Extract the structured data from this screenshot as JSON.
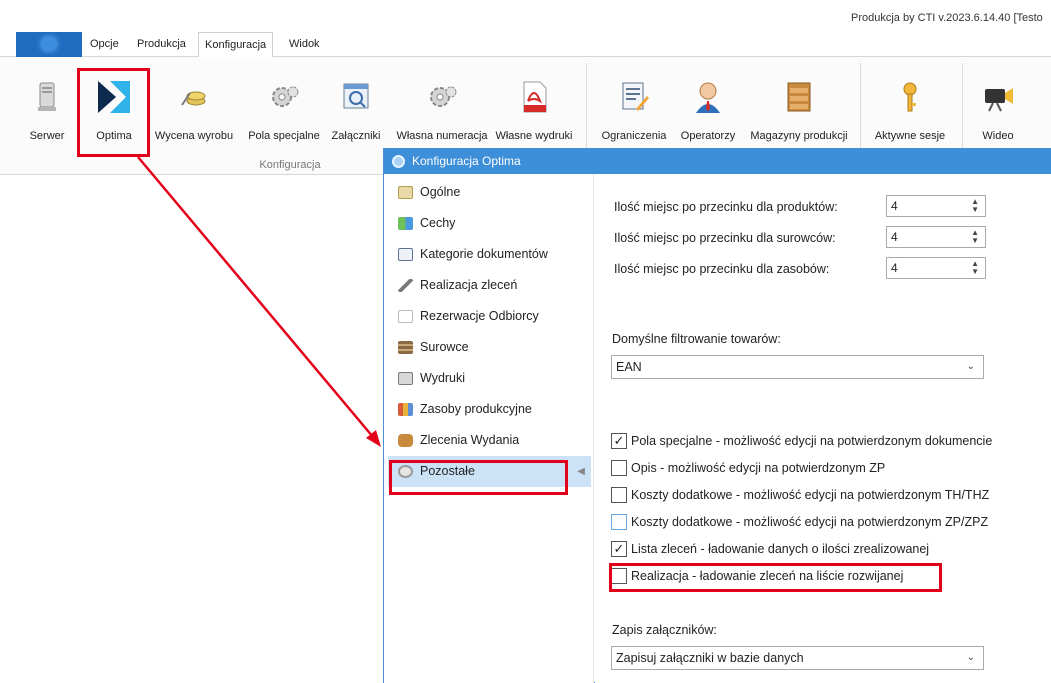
{
  "app": {
    "title": "Produkcja by CTI v.2023.6.14.40 [Testo"
  },
  "menu": {
    "tabs": [
      "Opcje",
      "Produkcja",
      "Konfiguracja",
      "Widok"
    ],
    "active": "Konfiguracja"
  },
  "ribbon": {
    "buttons": {
      "serwer": "Serwer",
      "optima": "Optima",
      "wycena": "Wycena wyrobu",
      "pola": "Pola specjalne",
      "zalaczniki": "Załączniki",
      "numeracja": "Własna numeracja",
      "wydruki": "Własne wydruki",
      "ograniczenia": "Ograniczenia",
      "operatorzy": "Operatorzy",
      "magazyny": "Magazyny produkcji",
      "sesje": "Aktywne sesje",
      "wideo": "Wideo"
    },
    "group_label": "Konfiguracja"
  },
  "dialog": {
    "title": "Konfiguracja Optima",
    "nav": [
      "Ogólne",
      "Cechy",
      "Kategorie dokumentów",
      "Realizacja zleceń",
      "Rezerwacje Odbiorcy",
      "Surowce",
      "Wydruki",
      "Zasoby produkcyjne",
      "Zlecenia Wydania",
      "Pozostałe"
    ],
    "selected_nav": "Pozostałe",
    "decimals": {
      "produkty_label": "Ilość miejsc po przecinku dla produktów:",
      "produkty_value": "4",
      "surowce_label": "Ilość miejsc po przecinku dla surowców:",
      "surowce_value": "4",
      "zasoby_label": "Ilość miejsc po przecinku dla zasobów:",
      "zasoby_value": "4"
    },
    "filter": {
      "label": "Domyślne filtrowanie towarów:",
      "value": "EAN"
    },
    "checkboxes": [
      {
        "label": "Pola specjalne - możliwość edycji na potwierdzonym dokumencie",
        "checked": true
      },
      {
        "label": "Opis - możliwość edycji na potwierdzonym ZP",
        "checked": false
      },
      {
        "label": "Koszty dodatkowe - możliwość edycji na potwierdzonym TH/THZ",
        "checked": false
      },
      {
        "label": "Koszty dodatkowe - możliwość edycji na potwierdzonym ZP/ZPZ",
        "checked": false
      },
      {
        "label": "Lista zleceń - ładowanie danych o ilości zrealizowanej",
        "checked": true
      },
      {
        "label": "Realizacja - ładowanie zleceń na liście rozwijanej",
        "checked": false
      }
    ],
    "attachments": {
      "label": "Zapis załączników:",
      "value": "Zapisuj załączniki w bazie danych"
    }
  },
  "colors": {
    "accent": "#3d8fd9",
    "highlight": "#e3001b",
    "selected_nav": "#cce3f7"
  }
}
